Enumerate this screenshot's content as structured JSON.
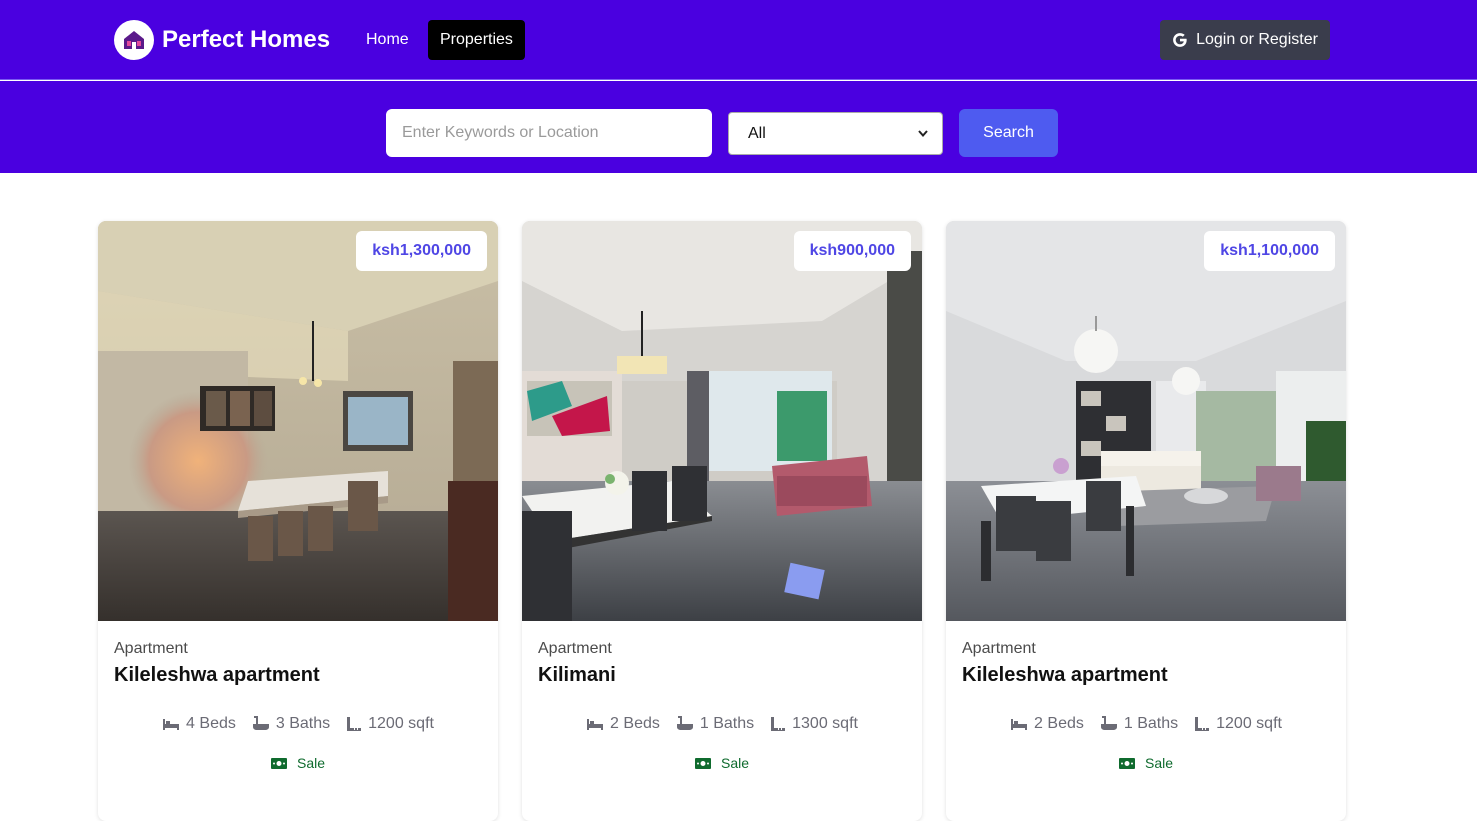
{
  "navbar": {
    "brand_name": "Perfect Homes",
    "logo_icon": "house-logo-icon",
    "links": [
      "Home",
      "Properties"
    ],
    "active_link": "Properties",
    "login_label": "Login or Register",
    "login_icon": "google-icon",
    "bg_color": "#4a00e0"
  },
  "search": {
    "placeholder": "Enter Keywords or Location",
    "value": "",
    "type_selected": "All",
    "button_label": "Search",
    "button_color": "#4e5bf0"
  },
  "listings": [
    {
      "price": "ksh1,300,000",
      "type": "Apartment",
      "title": "Kileleshwa apartment",
      "beds": "4 Beds",
      "baths": "3 Baths",
      "area": "1200 sqft",
      "status": "Sale",
      "image": "dining-room-photo"
    },
    {
      "price": "ksh900,000",
      "type": "Apartment",
      "title": "Kilimani",
      "beds": "2 Beds",
      "baths": "1 Baths",
      "area": "1300 sqft",
      "status": "Sale",
      "image": "open-plan-living-photo"
    },
    {
      "price": "ksh1,100,000",
      "type": "Apartment",
      "title": "Kileleshwa apartment",
      "beds": "2 Beds",
      "baths": "1 Baths",
      "area": "1200 sqft",
      "status": "Sale",
      "image": "bright-living-room-photo"
    }
  ],
  "colors": {
    "price": "#4f46e5",
    "status": "#0f6b2e"
  }
}
